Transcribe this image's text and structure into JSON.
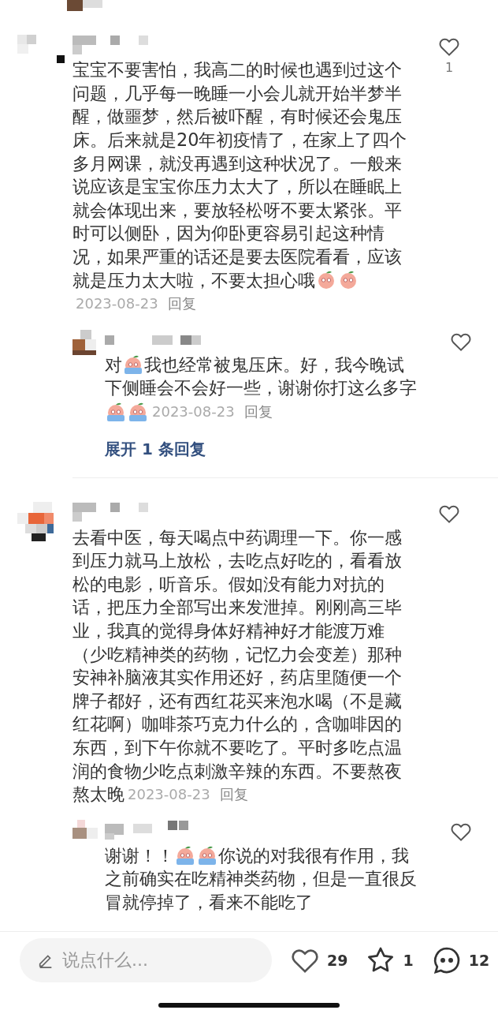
{
  "comments": [
    {
      "like_count": "1",
      "lines": [
        [
          {
            "kind": "text",
            "text": "宝宝不要害怕，我高二的时候也遇到过这个"
          }
        ],
        [
          {
            "kind": "text",
            "text": "问题，几乎每一晚睡一小会儿就开始半梦半"
          }
        ],
        [
          {
            "kind": "text",
            "text": "醒，做噩梦，然后被吓醒，有时候还会鬼压"
          }
        ],
        [
          {
            "kind": "text",
            "text": "床。后来就是20年初疫情了，在家上了四个"
          }
        ],
        [
          {
            "kind": "text",
            "text": "多月网课，就没再遇到这种状况了。一般来"
          }
        ],
        [
          {
            "kind": "text",
            "text": "说应该是宝宝你压力太大了，所以在睡眠上"
          }
        ],
        [
          {
            "kind": "text",
            "text": "就会体现出来，要放轻松呀不要太紧张。平"
          }
        ],
        [
          {
            "kind": "text",
            "text": "时可以侧卧，因为仰卧更容易引起这种情"
          }
        ],
        [
          {
            "kind": "text",
            "text": "况，如果严重的话还是要去医院看看，应该"
          }
        ],
        [
          {
            "kind": "text",
            "text": "就是压力太大啦，不要太担心哦"
          },
          {
            "kind": "peach"
          },
          {
            "kind": "peach"
          }
        ],
        [
          {
            "kind": "date",
            "text": "2023-08-23"
          },
          {
            "kind": "reply",
            "text": "回复"
          }
        ]
      ],
      "replies": [
        {
          "lines": [
            [
              {
                "kind": "text",
                "text": "对"
              },
              {
                "kind": "crying"
              },
              {
                "kind": "text",
                "text": "我也经常被鬼压床。好，我今晚试"
              }
            ],
            [
              {
                "kind": "text",
                "text": "下侧睡会不会好一些，谢谢你打这么多字"
              }
            ],
            [
              {
                "kind": "crying"
              },
              {
                "kind": "crying"
              },
              {
                "kind": "date",
                "text": "2023-08-23"
              },
              {
                "kind": "reply",
                "text": "回复"
              }
            ]
          ]
        }
      ],
      "expand_link": "展开 1 条回复"
    },
    {
      "lines": [
        [
          {
            "kind": "text",
            "text": "去看中医，每天喝点中药调理一下。你一感"
          }
        ],
        [
          {
            "kind": "text",
            "text": "到压力就马上放松，去吃点好吃的，看看放"
          }
        ],
        [
          {
            "kind": "text",
            "text": "松的电影，听音乐。假如没有能力对抗的"
          }
        ],
        [
          {
            "kind": "text",
            "text": "话，把压力全部写出来发泄掉。刚刚高三毕"
          }
        ],
        [
          {
            "kind": "text",
            "text": "业，我真的觉得身体好精神好才能渡万难"
          }
        ],
        [
          {
            "kind": "text",
            "text": "（少吃精神类的药物，记忆力会变差）那种"
          }
        ],
        [
          {
            "kind": "text",
            "text": "安神补脑液其实作用还好，药店里随便一个"
          }
        ],
        [
          {
            "kind": "text",
            "text": "牌子都好，还有西红花买来泡水喝（不是藏"
          }
        ],
        [
          {
            "kind": "text",
            "text": "红花啊）咖啡茶巧克力什么的，含咖啡因的"
          }
        ],
        [
          {
            "kind": "text",
            "text": "东西，到下午你就不要吃了。平时多吃点温"
          }
        ],
        [
          {
            "kind": "text",
            "text": "润的食物少吃点刺激辛辣的东西。不要熬夜"
          }
        ],
        [
          {
            "kind": "text",
            "text": "熬太晚"
          },
          {
            "kind": "date",
            "text": "2023-08-23"
          },
          {
            "kind": "reply",
            "text": "回复"
          }
        ]
      ],
      "replies": [
        {
          "lines": [
            [
              {
                "kind": "text",
                "text": "谢谢！！"
              },
              {
                "kind": "crying"
              },
              {
                "kind": "crying"
              },
              {
                "kind": "text",
                "text": "你说的对我很有作用，我"
              }
            ],
            [
              {
                "kind": "text",
                "text": "之前确实在吃精神类药物，但是一直很反"
              }
            ],
            [
              {
                "kind": "text",
                "text": "冒就停掉了，看来不能吃了"
              }
            ]
          ]
        }
      ]
    }
  ],
  "bottom_bar": {
    "placeholder": "说点什么...",
    "likes": "29",
    "stars": "1",
    "comments": "12"
  }
}
